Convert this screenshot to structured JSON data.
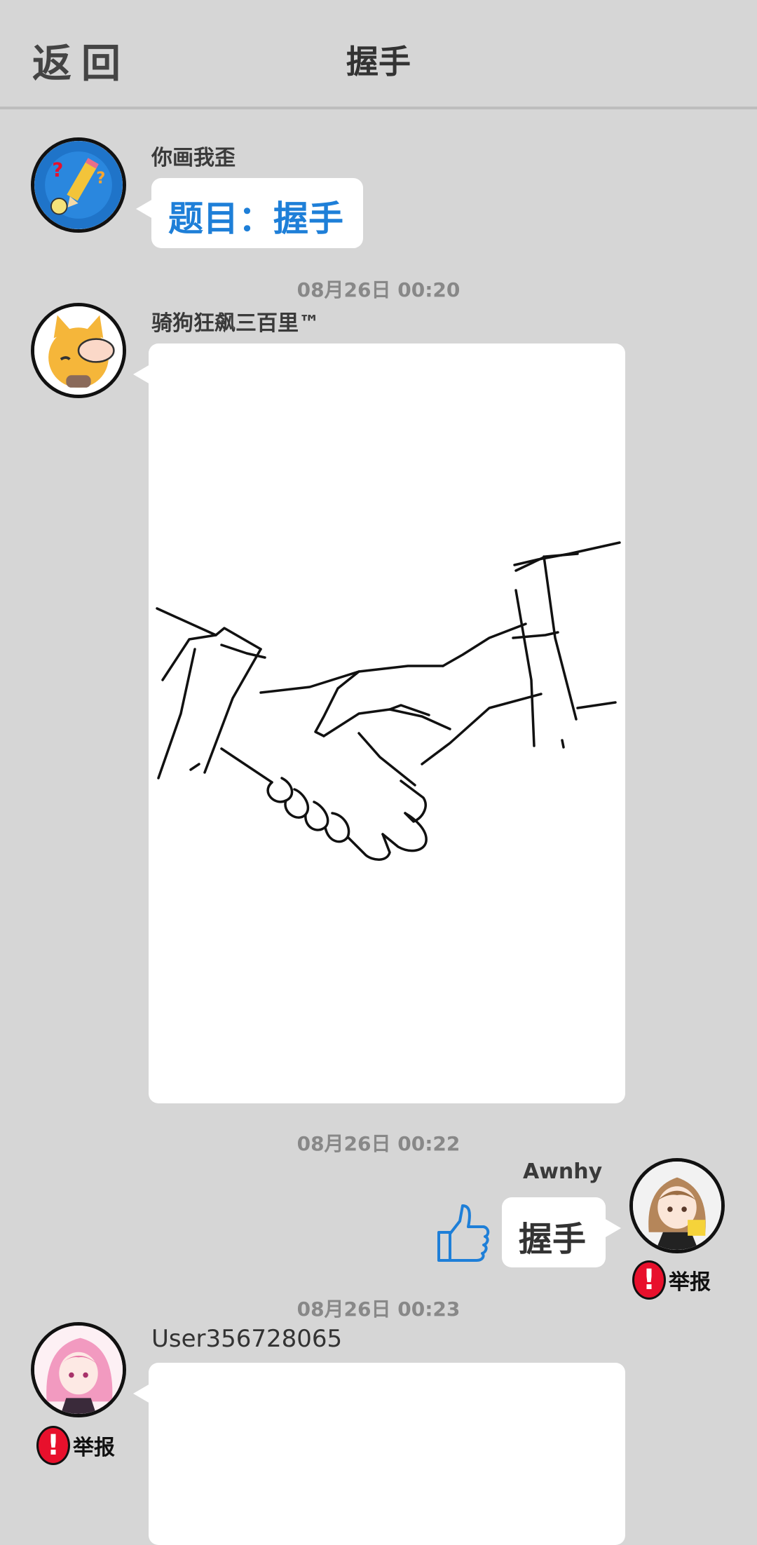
{
  "header": {
    "back_label": "返回",
    "title": "握手"
  },
  "messages": [
    {
      "username": "你画我歪",
      "topic": "题目：握手"
    },
    {
      "timestamp": "08月26日  00:20",
      "username": "骑狗狂飙三百里™"
    },
    {
      "timestamp": "08月26日  00:22",
      "username": "Awnhy",
      "text": "握手",
      "report_label": "举报"
    },
    {
      "timestamp": "08月26日  00:23",
      "username": "User356728065",
      "report_label": "举报"
    }
  ],
  "colors": {
    "background": "#d6d6d6",
    "topic": "#1e7fd8",
    "report": "#e8102c",
    "like": "#1e7fd8"
  },
  "icons": [
    "back",
    "pencil-avatar",
    "cat-avatar",
    "anime-girl-avatar",
    "thumbs-up-icon",
    "report-icon"
  ]
}
